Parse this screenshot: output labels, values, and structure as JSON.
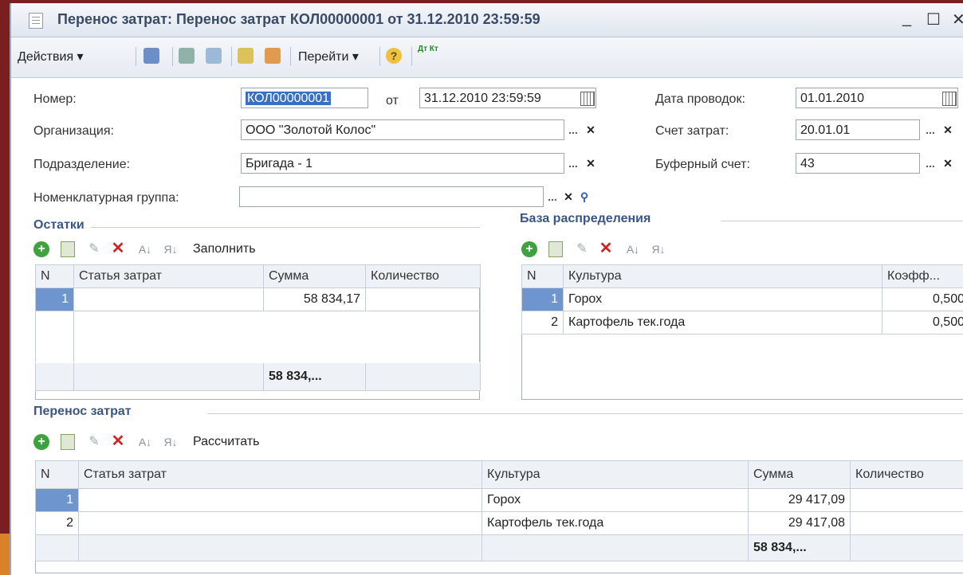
{
  "window": {
    "title": "Перенос затрат: Перенос затрат КОЛ00000001 от 31.12.2010 23:59:59",
    "controls": {
      "minimize": "_",
      "maximize": "☐",
      "close": "✕"
    }
  },
  "toolbar": {
    "actions_label": "Действия ▾",
    "goto_label": "Перейти ▾",
    "help_label": "?",
    "dtkt_label": "Дт Кт"
  },
  "form": {
    "number_label": "Номер:",
    "number_value": "КОЛ00000001",
    "from_label": "от",
    "date_value": "31.12.2010 23:59:59",
    "postings_date_label": "Дата проводок:",
    "postings_date_value": "01.01.2010",
    "org_label": "Организация:",
    "org_value": "ООО \"Золотой Колос\"",
    "cost_account_label": "Счет затрат:",
    "cost_account_value": "20.01.01",
    "division_label": "Подразделение:",
    "division_value": "Бригада - 1",
    "buffer_account_label": "Буферный счет:",
    "buffer_account_value": "43",
    "nomenclature_group_label": "Номенклатурная группа:",
    "nomenclature_group_value": ""
  },
  "balances": {
    "title": "Остатки",
    "fill_label": "Заполнить",
    "columns": [
      "N",
      "Статья затрат",
      "Сумма",
      "Количество"
    ],
    "rows": [
      {
        "n": "1",
        "item": "",
        "sum": "58 834,17",
        "qty": ""
      }
    ],
    "total_sum": "58 834,..."
  },
  "distribution_base": {
    "title": "База распределения",
    "columns": [
      "N",
      "Культура",
      "Коэфф..."
    ],
    "rows": [
      {
        "n": "1",
        "culture": "Горох",
        "coef": "0,500"
      },
      {
        "n": "2",
        "culture": "Картофель тек.года",
        "coef": "0,500"
      }
    ]
  },
  "cost_transfer": {
    "title": "Перенос затрат",
    "calc_label": "Рассчитать",
    "columns": [
      "N",
      "Статья затрат",
      "Культура",
      "Сумма",
      "Количество"
    ],
    "rows": [
      {
        "n": "1",
        "item": "",
        "culture": "Горох",
        "sum": "29 417,09",
        "qty": ""
      },
      {
        "n": "2",
        "item": "",
        "culture": "Картофель тек.года",
        "sum": "29 417,08",
        "qty": ""
      }
    ],
    "total_sum": "58 834,..."
  },
  "colors": {
    "accent": "#3a5587",
    "selection": "#6f95cf",
    "add_icon": "#3ea23e",
    "delete_icon": "#d02424"
  }
}
